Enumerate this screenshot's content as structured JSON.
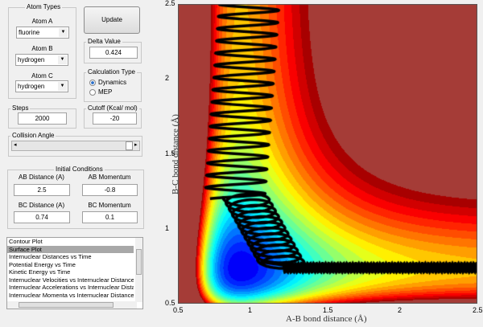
{
  "atom_types": {
    "title": "Atom Types",
    "atom_a_label": "Atom A",
    "atom_a": "fluorine",
    "atom_b_label": "Atom B",
    "atom_b": "hydrogen",
    "atom_c_label": "Atom C",
    "atom_c": "hydrogen"
  },
  "update_label": "Update",
  "delta": {
    "label": "Delta Value",
    "value": "0.424"
  },
  "calc_type": {
    "title": "Calculation Type",
    "options": [
      "Dynamics",
      "MEP"
    ],
    "selected": "Dynamics"
  },
  "steps": {
    "label": "Steps",
    "value": "2000"
  },
  "cutoff": {
    "label": "Cutoff (Kcal/ mol)",
    "value": "-20"
  },
  "collision_angle": {
    "label": "Collision Angle",
    "arrow_left": "◂",
    "arrow_right": "▸"
  },
  "initial": {
    "title": "Initial Conditions",
    "ab_dist_label": "AB Distance (A)",
    "ab_dist": "2.5",
    "ab_mom_label": "AB Momentum",
    "ab_mom": "-0.8",
    "bc_dist_label": "BC Distance (A)",
    "bc_dist": "0.74",
    "bc_mom_label": "BC Momentum",
    "bc_mom": "0.1"
  },
  "plot_list": {
    "items": [
      "Contour Plot",
      "Surface Plot",
      "Internuclear Distances vs Time",
      "Potential Energy vs Time",
      "Kinetic Energy vs Time",
      "Internuclear Velocities vs Internuclear Distance",
      "Internuclear Accelerations vs Internuclear Distance",
      "Internuclear Momenta vs Internuclear Distance"
    ],
    "selected": "Surface Plot"
  },
  "chart_data": {
    "type": "contour",
    "xlabel": "A-B bond distance (Å)",
    "ylabel": "B-C bond distance (Å)",
    "xlim": [
      0.5,
      2.5
    ],
    "ylim": [
      0.5,
      2.5
    ],
    "xticks": [
      "0.5",
      "1",
      "1.5",
      "2",
      "2.5"
    ],
    "yticks": [
      "0.5",
      "1",
      "1.5",
      "2",
      "2.5"
    ],
    "colormap": "jet",
    "trajectory_color": "#000000",
    "trajectory_start": [
      2.5,
      0.74
    ]
  }
}
